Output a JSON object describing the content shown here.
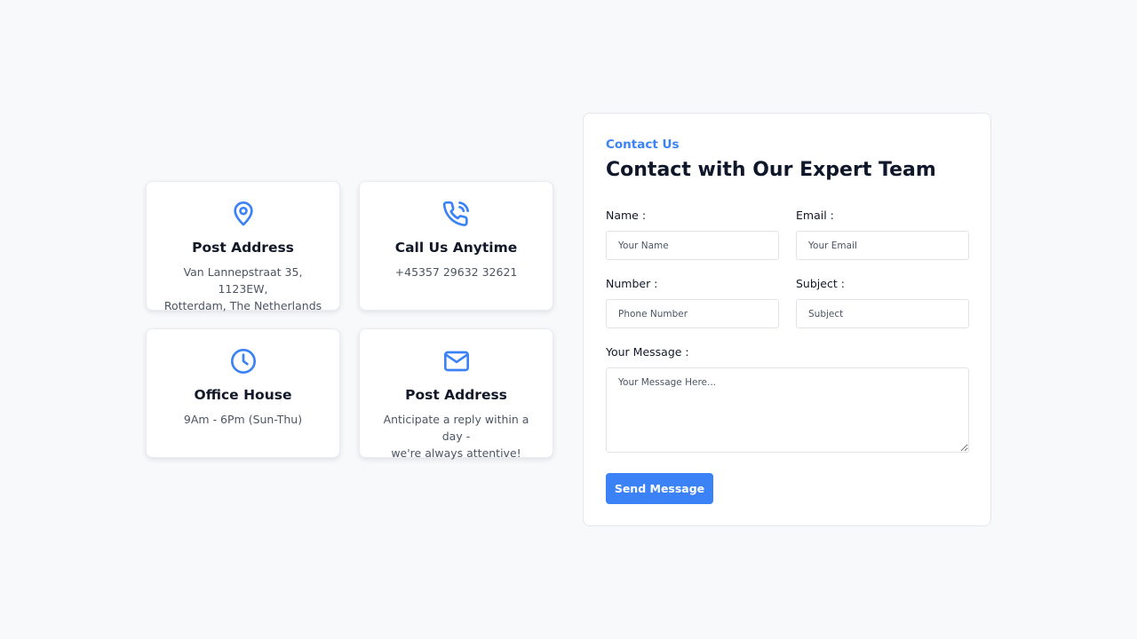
{
  "colors": {
    "accent": "#3b82f6",
    "background": "#f8f9fb",
    "card": "#ffffff"
  },
  "info_cards": [
    {
      "icon": "map-pin-icon",
      "title": "Post Address",
      "line1": "Van Lannepstraat 35, 1123EW,",
      "line2": "Rotterdam, The Netherlands"
    },
    {
      "icon": "phone-icon",
      "title": "Call Us Anytime",
      "line1": "+45357 29632 32621",
      "line2": ""
    },
    {
      "icon": "clock-icon",
      "title": "Office House",
      "line1": "9Am - 6Pm (Sun-Thu)",
      "line2": ""
    },
    {
      "icon": "mail-icon",
      "title": "Post Address",
      "line1": "Anticipate a reply within a day -",
      "line2": "we're always attentive!"
    }
  ],
  "form": {
    "eyebrow": "Contact Us",
    "title": "Contact with Our Expert Team",
    "name_label": "Name :",
    "name_placeholder": "Your Name",
    "name_value": "",
    "email_label": "Email :",
    "email_placeholder": "Your Email",
    "email_value": "",
    "number_label": "Number :",
    "number_placeholder": "Phone Number",
    "number_value": "",
    "subject_label": "Subject :",
    "subject_placeholder": "Subject",
    "subject_value": "",
    "message_label": "Your Message :",
    "message_placeholder": "Your Message Here...",
    "message_value": "",
    "submit_label": "Send Message"
  }
}
